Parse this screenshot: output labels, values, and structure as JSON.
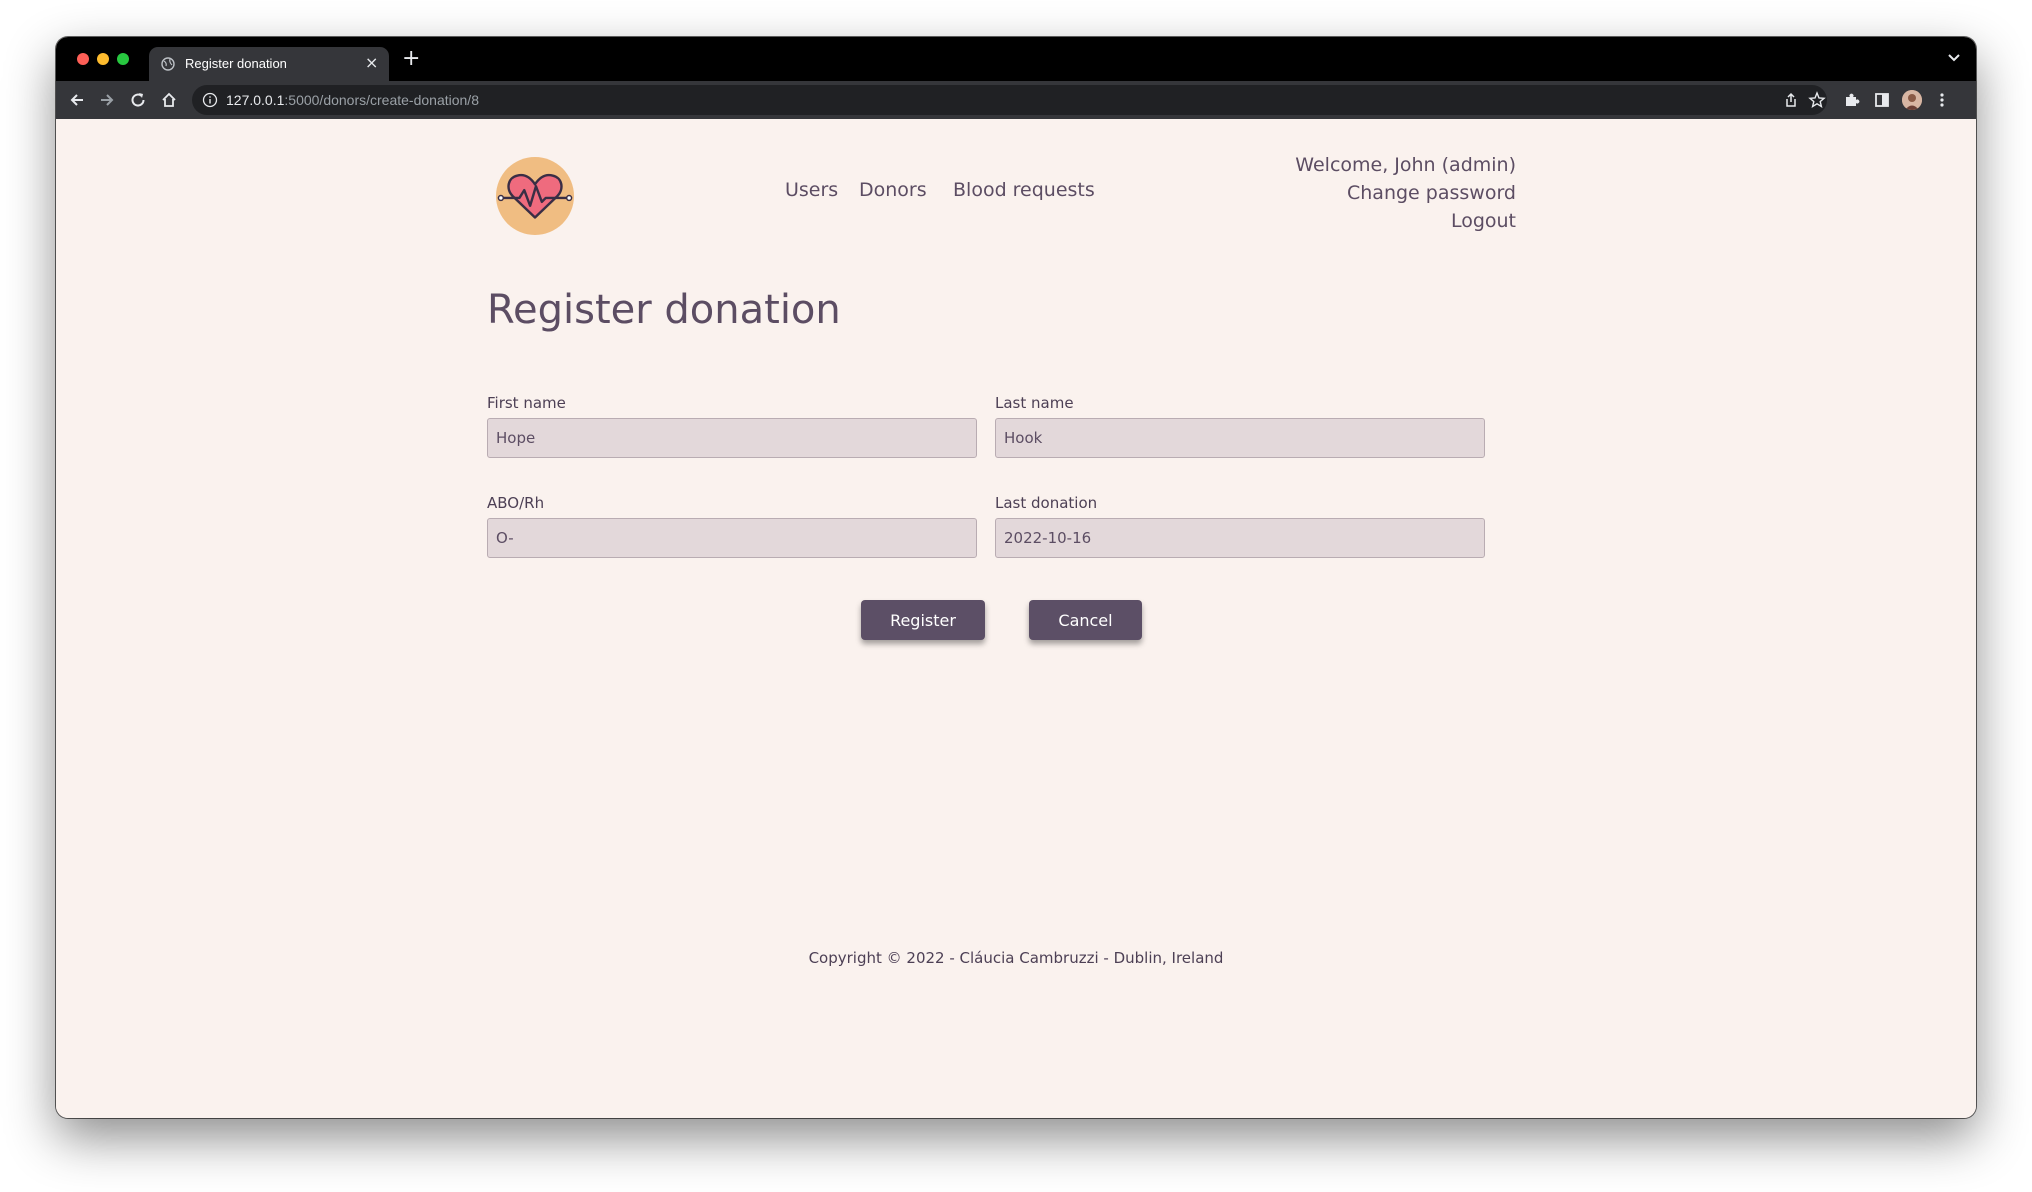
{
  "browser": {
    "tab_title": "Register donation",
    "tab_close": "×",
    "new_tab": "+",
    "url_host": "127.0.0.1",
    "url_path": ":5000/donors/create-donation/8"
  },
  "header": {
    "nav": [
      {
        "label": "Users"
      },
      {
        "label": "Donors"
      },
      {
        "label": "Blood requests"
      }
    ],
    "welcome": "Welcome, John (admin)",
    "change_password": "Change password",
    "logout": "Logout"
  },
  "main": {
    "title": "Register donation",
    "fields": {
      "first_name": {
        "label": "First name",
        "value": "Hope"
      },
      "last_name": {
        "label": "Last name",
        "value": "Hook"
      },
      "abo_rh": {
        "label": "ABO/Rh",
        "value": "O-"
      },
      "last_donation": {
        "label": "Last donation",
        "value": "2022-10-16"
      }
    },
    "register_label": "Register",
    "cancel_label": "Cancel"
  },
  "footer": {
    "copyright": "Copyright © 2022 - Cláucia Cambruzzi - Dublin, Ireland"
  },
  "colors": {
    "page_bg": "#faf2ee",
    "text": "#5c4d63",
    "button_bg": "#5c4f66",
    "input_bg": "#e3d8da",
    "logo_circle": "#f0bd82",
    "logo_heart": "#ef6b7e"
  },
  "icons": {
    "back": "back-arrow-icon",
    "forward": "forward-arrow-icon",
    "reload": "reload-icon",
    "home": "home-icon",
    "info": "info-icon",
    "share": "share-icon",
    "bookmark": "star-icon",
    "extensions": "puzzle-icon",
    "sidebar": "side-panel-icon",
    "menu": "kebab-menu-icon",
    "logo": "heartbeat-logo-icon"
  }
}
